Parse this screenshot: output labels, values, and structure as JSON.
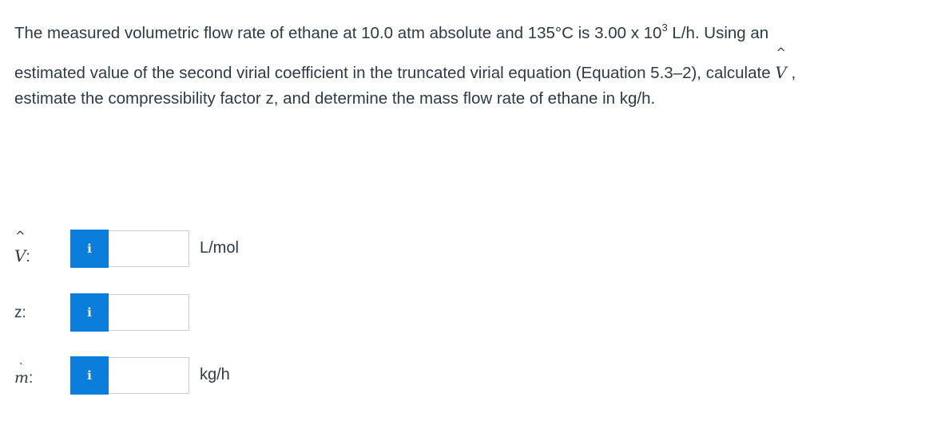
{
  "question": {
    "line1_pre": "The measured volumetric flow rate of ethane at 10.0 atm absolute and 135°C is 3.00 x 10",
    "line1_exp": "3",
    "line1_post": " L/h. Using an",
    "line2_pre": "estimated value of the second virial coefficient in the truncated virial equation (Equation 5.3–2), calculate ",
    "line2_symbol": "V",
    "line2_hat": "^",
    "line2_post": " ,",
    "line3": "estimate the compressibility factor z, and determine the mass flow rate of ethane in kg/h."
  },
  "answers": [
    {
      "symbol": "V",
      "hat": "^",
      "colon": ":",
      "info": "i",
      "value": "",
      "unit": "L/mol"
    },
    {
      "symbol": "z:",
      "info": "i",
      "value": "",
      "unit": ""
    },
    {
      "symbol": "m",
      "dot": "·",
      "colon": ":",
      "info": "i",
      "value": "",
      "unit": "kg/h"
    }
  ],
  "colors": {
    "info_button": "#0b7ddb",
    "text": "#2d3b45",
    "input_border": "#c7cdd1"
  },
  "icons": {
    "info": "info-icon"
  }
}
